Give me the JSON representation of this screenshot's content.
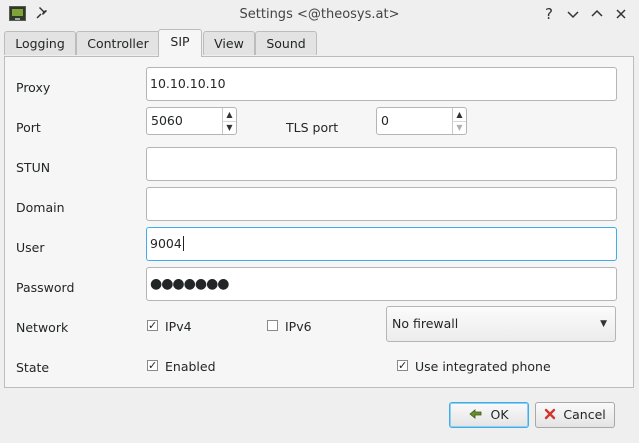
{
  "window": {
    "title": "Settings <@theosys.at>",
    "help_glyph": "?",
    "minimize_glyph": "⌄",
    "maximize_glyph": "⌃",
    "close_glyph": "✕"
  },
  "tabs": [
    "Logging",
    "Controller",
    "SIP",
    "View",
    "Sound"
  ],
  "active_tab": "SIP",
  "form": {
    "proxy_label": "Proxy",
    "proxy_value": "10.10.10.10",
    "port_label": "Port",
    "port_value": "5060",
    "tls_port_label": "TLS port",
    "tls_port_value": "0",
    "stun_label": "STUN",
    "stun_value": "",
    "domain_label": "Domain",
    "domain_value": "",
    "user_label": "User",
    "user_value": "9004",
    "password_label": "Password",
    "password_value": "●●●●●●●",
    "network_label": "Network",
    "ipv4_label": "IPv4",
    "ipv4_checked": true,
    "ipv6_label": "IPv6",
    "ipv6_checked": false,
    "firewall_selected": "No firewall",
    "state_label": "State",
    "enabled_label": "Enabled",
    "enabled_checked": true,
    "integrated_phone_label": "Use integrated phone",
    "integrated_phone_checked": true
  },
  "buttons": {
    "ok_label": "OK",
    "cancel_label": "Cancel"
  },
  "icons": {
    "app": "monitor-icon",
    "pin": "pin-icon",
    "ok": "hand-pointer-icon",
    "cancel": "red-x-icon"
  },
  "colors": {
    "focus": "#3daee9",
    "cancel_icon": "#d0362f",
    "ok_icon": "#6a8f2d"
  }
}
